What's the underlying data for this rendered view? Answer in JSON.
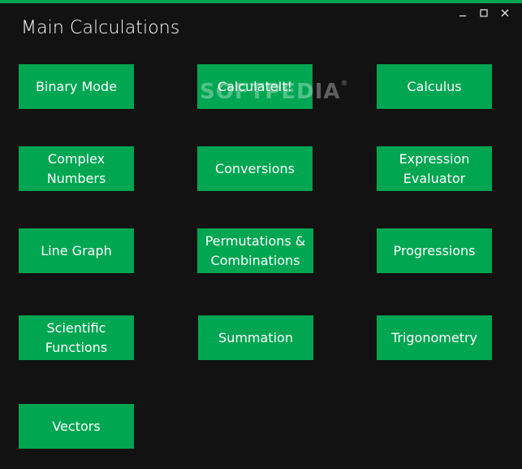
{
  "window": {
    "title": "Main Calculations",
    "controls": {
      "minimize_icon": "minimize-icon",
      "maximize_icon": "maximize-icon",
      "close_icon": "close-icon"
    }
  },
  "tiles": [
    {
      "id": "binary-mode",
      "label": "Binary Mode"
    },
    {
      "id": "calculateit",
      "label": "CalculateIt!"
    },
    {
      "id": "calculus",
      "label": "Calculus"
    },
    {
      "id": "complex-numbers",
      "label": "Complex Numbers"
    },
    {
      "id": "conversions",
      "label": "Conversions"
    },
    {
      "id": "expression-evaluator",
      "label": "Expression Evaluator"
    },
    {
      "id": "line-graph",
      "label": "Line Graph"
    },
    {
      "id": "permutations-combinations",
      "label": "Permutations & Combinations"
    },
    {
      "id": "progressions",
      "label": "Progressions"
    },
    {
      "id": "scientific-functions",
      "label": "Scientific Functions"
    },
    {
      "id": "summation",
      "label": "Summation"
    },
    {
      "id": "trigonometry",
      "label": "Trigonometry"
    },
    {
      "id": "vectors",
      "label": "Vectors"
    }
  ],
  "watermark": {
    "text": "SOFTPEDIA",
    "mark": "®"
  },
  "colors": {
    "background": "#121212",
    "accent": "#00a651",
    "text": "#ffffff"
  }
}
